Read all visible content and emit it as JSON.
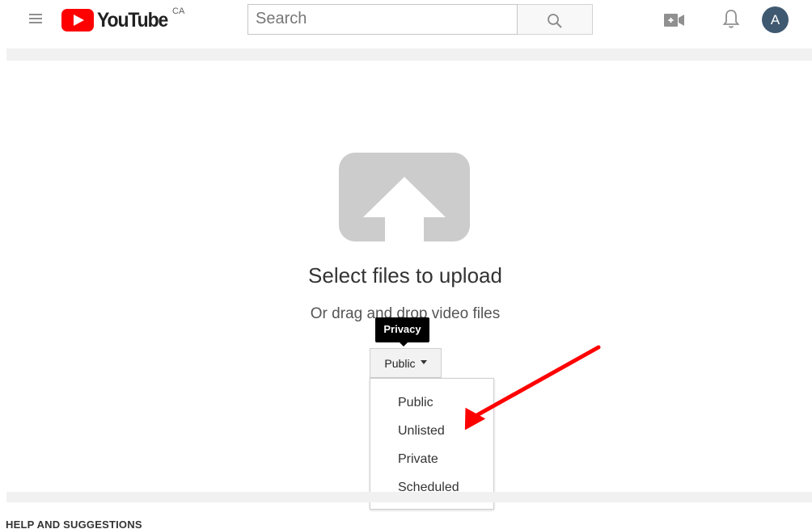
{
  "header": {
    "logo_text": "YouTube",
    "region": "CA",
    "search_placeholder": "Search",
    "avatar_letter": "A"
  },
  "upload": {
    "title": "Select files to upload",
    "subtitle": "Or drag and drop video files"
  },
  "privacy": {
    "tooltip": "Privacy",
    "selected": "Public",
    "options": [
      "Public",
      "Unlisted",
      "Private",
      "Scheduled"
    ]
  },
  "footer": {
    "help_heading": "HELP AND SUGGESTIONS"
  },
  "colors": {
    "brand_red": "#ff0000",
    "annotation_arrow": "#ff0000",
    "avatar_bg": "#3f5970"
  },
  "icons": [
    "menu-icon",
    "youtube-play-icon",
    "search-icon",
    "create-video-icon",
    "bell-icon",
    "upload-arrow-icon",
    "caret-down-icon",
    "annotation-arrow"
  ]
}
